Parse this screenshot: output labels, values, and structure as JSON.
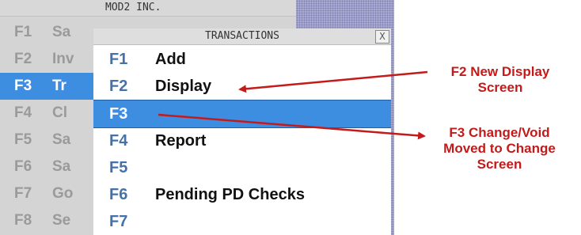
{
  "app": {
    "title": "MOD2 INC.",
    "menu": [
      {
        "key": "F1",
        "label": "Sa"
      },
      {
        "key": "F2",
        "label": "Inv"
      },
      {
        "key": "F3",
        "label": "Tr"
      },
      {
        "key": "F4",
        "label": "Cl"
      },
      {
        "key": "F5",
        "label": "Sa"
      },
      {
        "key": "F6",
        "label": "Sa"
      },
      {
        "key": "F7",
        "label": "Go"
      },
      {
        "key": "F8",
        "label": "Se"
      }
    ]
  },
  "dialog": {
    "title": "TRANSACTIONS",
    "close_label": "X",
    "options": [
      {
        "key": "F1",
        "label": "Add"
      },
      {
        "key": "F2",
        "label": "Display"
      },
      {
        "key": "F3",
        "label": ""
      },
      {
        "key": "F4",
        "label": "Report"
      },
      {
        "key": "F5",
        "label": ""
      },
      {
        "key": "F6",
        "label": "Pending PD Checks"
      },
      {
        "key": "F7",
        "label": ""
      }
    ]
  },
  "annotations": {
    "note_1": [
      "F2 New Display",
      "Screen"
    ],
    "note_2": [
      "F3 Change/Void",
      "Moved to Change",
      "Screen"
    ]
  },
  "colors": {
    "selection": "#3d8ee0",
    "annotation": "#c41a1a"
  }
}
